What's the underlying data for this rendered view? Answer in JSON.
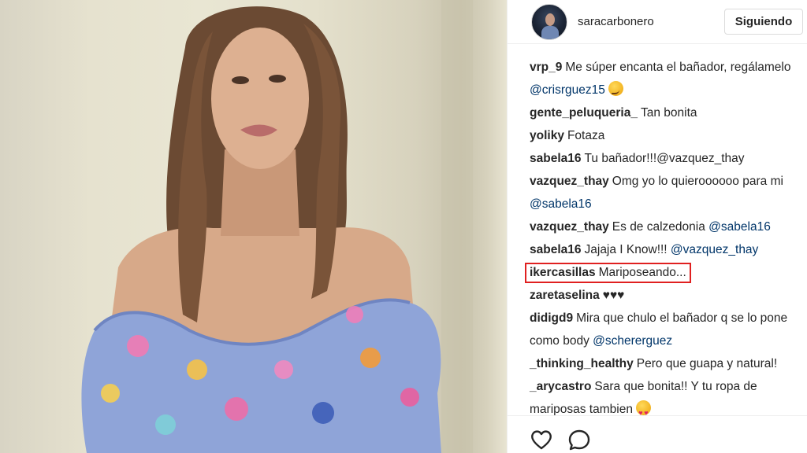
{
  "post": {
    "username": "saracarbonero",
    "follow_label": "Siguiendo"
  },
  "icons": {
    "like": "heart-outline-icon",
    "comment": "speech-bubble-icon"
  },
  "colors": {
    "mention": "#003569",
    "highlight_border": "#e02020",
    "text": "#262626"
  },
  "comments": [
    {
      "user": "vrp_9",
      "text": "Me súper encanta el bañador, regálamelo",
      "mention": "@crisrguez15",
      "emoji": "smirk"
    },
    {
      "user": "gente_peluqueria_",
      "text": "Tan bonita"
    },
    {
      "user": "yoliky",
      "text": "Fotaza"
    },
    {
      "user": "sabela16",
      "text": "Tu bañador!!!@vazquez_thay"
    },
    {
      "user": "vazquez_thay",
      "text": "Omg yo lo quieroooooo para mi",
      "mention": "@sabela16"
    },
    {
      "user": "vazquez_thay",
      "text": "Es de calzedonia",
      "mention": "@sabela16"
    },
    {
      "user": "sabela16",
      "text": "Jajaja I Know!!!",
      "mention": "@vazquez_thay"
    },
    {
      "user": "ikercasillas",
      "text": "Mariposeando..."
    },
    {
      "user": "zaretaselina",
      "text": "♥♥♥"
    },
    {
      "user": "didigd9",
      "text": "Mira que chulo el bañador q se lo pone como body",
      "mention": "@schererguez"
    },
    {
      "user": "_thinking_healthy",
      "text": "Pero que guapa y natural!"
    },
    {
      "user": "_arycastro",
      "text": "Sara que bonita!! Y tu ropa de mariposas tambien",
      "emoji": "heart-eyes"
    }
  ]
}
